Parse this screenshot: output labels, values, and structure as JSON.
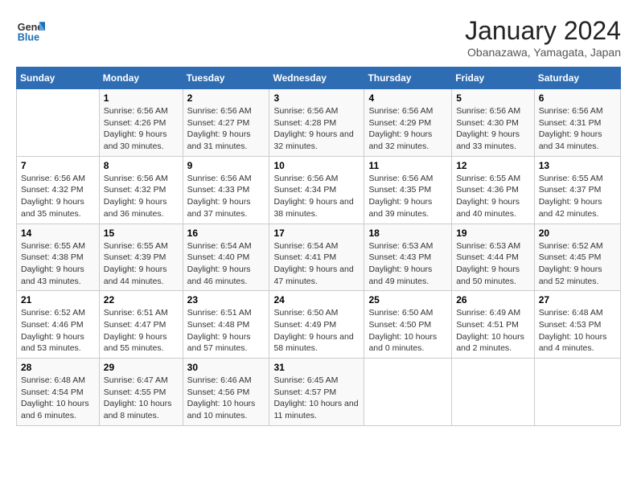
{
  "logo": {
    "line1": "General",
    "line2": "Blue"
  },
  "title": "January 2024",
  "subtitle": "Obanazawa, Yamagata, Japan",
  "days_of_week": [
    "Sunday",
    "Monday",
    "Tuesday",
    "Wednesday",
    "Thursday",
    "Friday",
    "Saturday"
  ],
  "weeks": [
    [
      {
        "num": "",
        "sunrise": "",
        "sunset": "",
        "daylight": ""
      },
      {
        "num": "1",
        "sunrise": "Sunrise: 6:56 AM",
        "sunset": "Sunset: 4:26 PM",
        "daylight": "Daylight: 9 hours and 30 minutes."
      },
      {
        "num": "2",
        "sunrise": "Sunrise: 6:56 AM",
        "sunset": "Sunset: 4:27 PM",
        "daylight": "Daylight: 9 hours and 31 minutes."
      },
      {
        "num": "3",
        "sunrise": "Sunrise: 6:56 AM",
        "sunset": "Sunset: 4:28 PM",
        "daylight": "Daylight: 9 hours and 32 minutes."
      },
      {
        "num": "4",
        "sunrise": "Sunrise: 6:56 AM",
        "sunset": "Sunset: 4:29 PM",
        "daylight": "Daylight: 9 hours and 32 minutes."
      },
      {
        "num": "5",
        "sunrise": "Sunrise: 6:56 AM",
        "sunset": "Sunset: 4:30 PM",
        "daylight": "Daylight: 9 hours and 33 minutes."
      },
      {
        "num": "6",
        "sunrise": "Sunrise: 6:56 AM",
        "sunset": "Sunset: 4:31 PM",
        "daylight": "Daylight: 9 hours and 34 minutes."
      }
    ],
    [
      {
        "num": "7",
        "sunrise": "Sunrise: 6:56 AM",
        "sunset": "Sunset: 4:32 PM",
        "daylight": "Daylight: 9 hours and 35 minutes."
      },
      {
        "num": "8",
        "sunrise": "Sunrise: 6:56 AM",
        "sunset": "Sunset: 4:32 PM",
        "daylight": "Daylight: 9 hours and 36 minutes."
      },
      {
        "num": "9",
        "sunrise": "Sunrise: 6:56 AM",
        "sunset": "Sunset: 4:33 PM",
        "daylight": "Daylight: 9 hours and 37 minutes."
      },
      {
        "num": "10",
        "sunrise": "Sunrise: 6:56 AM",
        "sunset": "Sunset: 4:34 PM",
        "daylight": "Daylight: 9 hours and 38 minutes."
      },
      {
        "num": "11",
        "sunrise": "Sunrise: 6:56 AM",
        "sunset": "Sunset: 4:35 PM",
        "daylight": "Daylight: 9 hours and 39 minutes."
      },
      {
        "num": "12",
        "sunrise": "Sunrise: 6:55 AM",
        "sunset": "Sunset: 4:36 PM",
        "daylight": "Daylight: 9 hours and 40 minutes."
      },
      {
        "num": "13",
        "sunrise": "Sunrise: 6:55 AM",
        "sunset": "Sunset: 4:37 PM",
        "daylight": "Daylight: 9 hours and 42 minutes."
      }
    ],
    [
      {
        "num": "14",
        "sunrise": "Sunrise: 6:55 AM",
        "sunset": "Sunset: 4:38 PM",
        "daylight": "Daylight: 9 hours and 43 minutes."
      },
      {
        "num": "15",
        "sunrise": "Sunrise: 6:55 AM",
        "sunset": "Sunset: 4:39 PM",
        "daylight": "Daylight: 9 hours and 44 minutes."
      },
      {
        "num": "16",
        "sunrise": "Sunrise: 6:54 AM",
        "sunset": "Sunset: 4:40 PM",
        "daylight": "Daylight: 9 hours and 46 minutes."
      },
      {
        "num": "17",
        "sunrise": "Sunrise: 6:54 AM",
        "sunset": "Sunset: 4:41 PM",
        "daylight": "Daylight: 9 hours and 47 minutes."
      },
      {
        "num": "18",
        "sunrise": "Sunrise: 6:53 AM",
        "sunset": "Sunset: 4:43 PM",
        "daylight": "Daylight: 9 hours and 49 minutes."
      },
      {
        "num": "19",
        "sunrise": "Sunrise: 6:53 AM",
        "sunset": "Sunset: 4:44 PM",
        "daylight": "Daylight: 9 hours and 50 minutes."
      },
      {
        "num": "20",
        "sunrise": "Sunrise: 6:52 AM",
        "sunset": "Sunset: 4:45 PM",
        "daylight": "Daylight: 9 hours and 52 minutes."
      }
    ],
    [
      {
        "num": "21",
        "sunrise": "Sunrise: 6:52 AM",
        "sunset": "Sunset: 4:46 PM",
        "daylight": "Daylight: 9 hours and 53 minutes."
      },
      {
        "num": "22",
        "sunrise": "Sunrise: 6:51 AM",
        "sunset": "Sunset: 4:47 PM",
        "daylight": "Daylight: 9 hours and 55 minutes."
      },
      {
        "num": "23",
        "sunrise": "Sunrise: 6:51 AM",
        "sunset": "Sunset: 4:48 PM",
        "daylight": "Daylight: 9 hours and 57 minutes."
      },
      {
        "num": "24",
        "sunrise": "Sunrise: 6:50 AM",
        "sunset": "Sunset: 4:49 PM",
        "daylight": "Daylight: 9 hours and 58 minutes."
      },
      {
        "num": "25",
        "sunrise": "Sunrise: 6:50 AM",
        "sunset": "Sunset: 4:50 PM",
        "daylight": "Daylight: 10 hours and 0 minutes."
      },
      {
        "num": "26",
        "sunrise": "Sunrise: 6:49 AM",
        "sunset": "Sunset: 4:51 PM",
        "daylight": "Daylight: 10 hours and 2 minutes."
      },
      {
        "num": "27",
        "sunrise": "Sunrise: 6:48 AM",
        "sunset": "Sunset: 4:53 PM",
        "daylight": "Daylight: 10 hours and 4 minutes."
      }
    ],
    [
      {
        "num": "28",
        "sunrise": "Sunrise: 6:48 AM",
        "sunset": "Sunset: 4:54 PM",
        "daylight": "Daylight: 10 hours and 6 minutes."
      },
      {
        "num": "29",
        "sunrise": "Sunrise: 6:47 AM",
        "sunset": "Sunset: 4:55 PM",
        "daylight": "Daylight: 10 hours and 8 minutes."
      },
      {
        "num": "30",
        "sunrise": "Sunrise: 6:46 AM",
        "sunset": "Sunset: 4:56 PM",
        "daylight": "Daylight: 10 hours and 10 minutes."
      },
      {
        "num": "31",
        "sunrise": "Sunrise: 6:45 AM",
        "sunset": "Sunset: 4:57 PM",
        "daylight": "Daylight: 10 hours and 11 minutes."
      },
      {
        "num": "",
        "sunrise": "",
        "sunset": "",
        "daylight": ""
      },
      {
        "num": "",
        "sunrise": "",
        "sunset": "",
        "daylight": ""
      },
      {
        "num": "",
        "sunrise": "",
        "sunset": "",
        "daylight": ""
      }
    ]
  ]
}
